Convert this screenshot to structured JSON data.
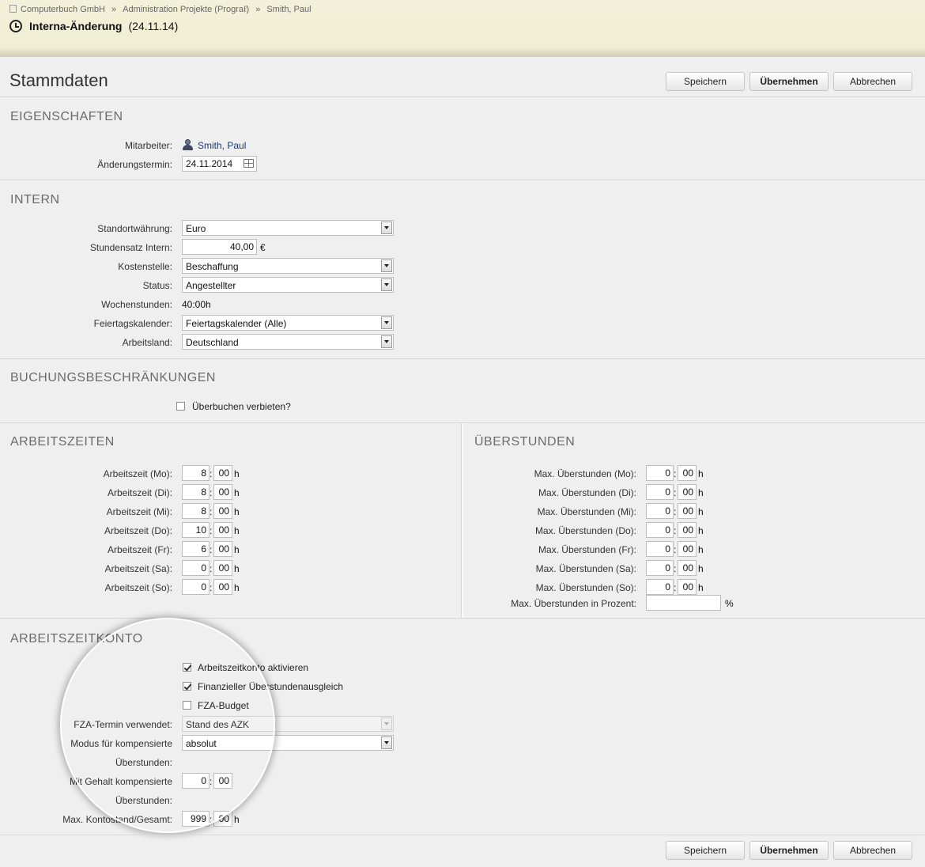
{
  "header": {
    "breadcrumb": [
      "Computerbuch GmbH",
      "Administration Projekte (Prograℓ)",
      "Smith, Paul"
    ],
    "breadcrumb_sep": "»",
    "title": "Interna-Änderung",
    "date": "(24.11.14)"
  },
  "page_title": "Stammdaten",
  "buttons": {
    "save": "Speichern",
    "apply": "Übernehmen",
    "cancel": "Abbrechen"
  },
  "eigenschaften": {
    "heading": "EIGENSCHAFTEN",
    "mitarbeiter_label": "Mitarbeiter:",
    "mitarbeiter_value": "Smith, Paul",
    "termin_label": "Änderungstermin:",
    "termin_value": "24.11.2014"
  },
  "intern": {
    "heading": "INTERN",
    "waehrung_label": "Standortwährung:",
    "waehrung_value": "Euro",
    "stundensatz_label": "Stundensatz Intern:",
    "stundensatz_value": "40,00",
    "stundensatz_unit": "€",
    "kostenstelle_label": "Kostenstelle:",
    "kostenstelle_value": "Beschaffung",
    "status_label": "Status:",
    "status_value": "Angestellter",
    "wochenstunden_label": "Wochenstunden:",
    "wochenstunden_value": "40:00h",
    "feiertag_label": "Feiertagskalender:",
    "feiertag_value": "Feiertagskalender (Alle)",
    "arbeitsland_label": "Arbeitsland:",
    "arbeitsland_value": "Deutschland"
  },
  "buchung": {
    "heading": "BUCHUNGSBESCHRÄNKUNGEN",
    "ueberbuchen_label": "Überbuchen verbieten?",
    "ueberbuchen_checked": false
  },
  "arbeitszeiten": {
    "heading": "ARBEITSZEITEN",
    "rows": [
      {
        "label": "Arbeitszeit (Mo):",
        "hours": "8",
        "minutes": "00"
      },
      {
        "label": "Arbeitszeit (Di):",
        "hours": "8",
        "minutes": "00"
      },
      {
        "label": "Arbeitszeit (Mi):",
        "hours": "8",
        "minutes": "00"
      },
      {
        "label": "Arbeitszeit (Do):",
        "hours": "10",
        "minutes": "00"
      },
      {
        "label": "Arbeitszeit (Fr):",
        "hours": "6",
        "minutes": "00"
      },
      {
        "label": "Arbeitszeit (Sa):",
        "hours": "0",
        "minutes": "00"
      },
      {
        "label": "Arbeitszeit (So):",
        "hours": "0",
        "minutes": "00"
      }
    ],
    "colon": ":",
    "h_unit": "h"
  },
  "ueberstunden": {
    "heading": "ÜBERSTUNDEN",
    "rows": [
      {
        "label": "Max. Überstunden (Mo):",
        "hours": "0",
        "minutes": "00"
      },
      {
        "label": "Max. Überstunden (Di):",
        "hours": "0",
        "minutes": "00"
      },
      {
        "label": "Max. Überstunden (Mi):",
        "hours": "0",
        "minutes": "00"
      },
      {
        "label": "Max. Überstunden (Do):",
        "hours": "0",
        "minutes": "00"
      },
      {
        "label": "Max. Überstunden (Fr):",
        "hours": "0",
        "minutes": "00"
      },
      {
        "label": "Max. Überstunden (Sa):",
        "hours": "0",
        "minutes": "00"
      },
      {
        "label": "Max. Überstunden (So):",
        "hours": "0",
        "minutes": "00"
      }
    ],
    "prozent_label": "Max. Überstunden in Prozent:",
    "prozent_value": "",
    "prozent_unit": "%"
  },
  "konto": {
    "heading": "ARBEITSZEITKONTO",
    "aktivieren_label": "Arbeitszeitkonto aktivieren",
    "aktivieren_checked": true,
    "finanziell_label": "Finanzieller Überstundenausgleich",
    "finanziell_checked": true,
    "fza_budget_label": "FZA-Budget",
    "fza_budget_checked": false,
    "fza_termin_label": "FZA-Termin verwendet:",
    "fza_termin_value": "Stand des AZK",
    "modus_label": "Modus für kompensierte",
    "modus_label2": "Überstunden:",
    "modus_value": "absolut",
    "gehalt_label": "Mit Gehalt kompensierte",
    "gehalt_label2": "Überstunden:",
    "gehalt_hours": "0",
    "gehalt_minutes": "00",
    "max_label": "Max. Kontostand/Gesamt:",
    "max_hours": "999",
    "max_minutes": "00"
  }
}
